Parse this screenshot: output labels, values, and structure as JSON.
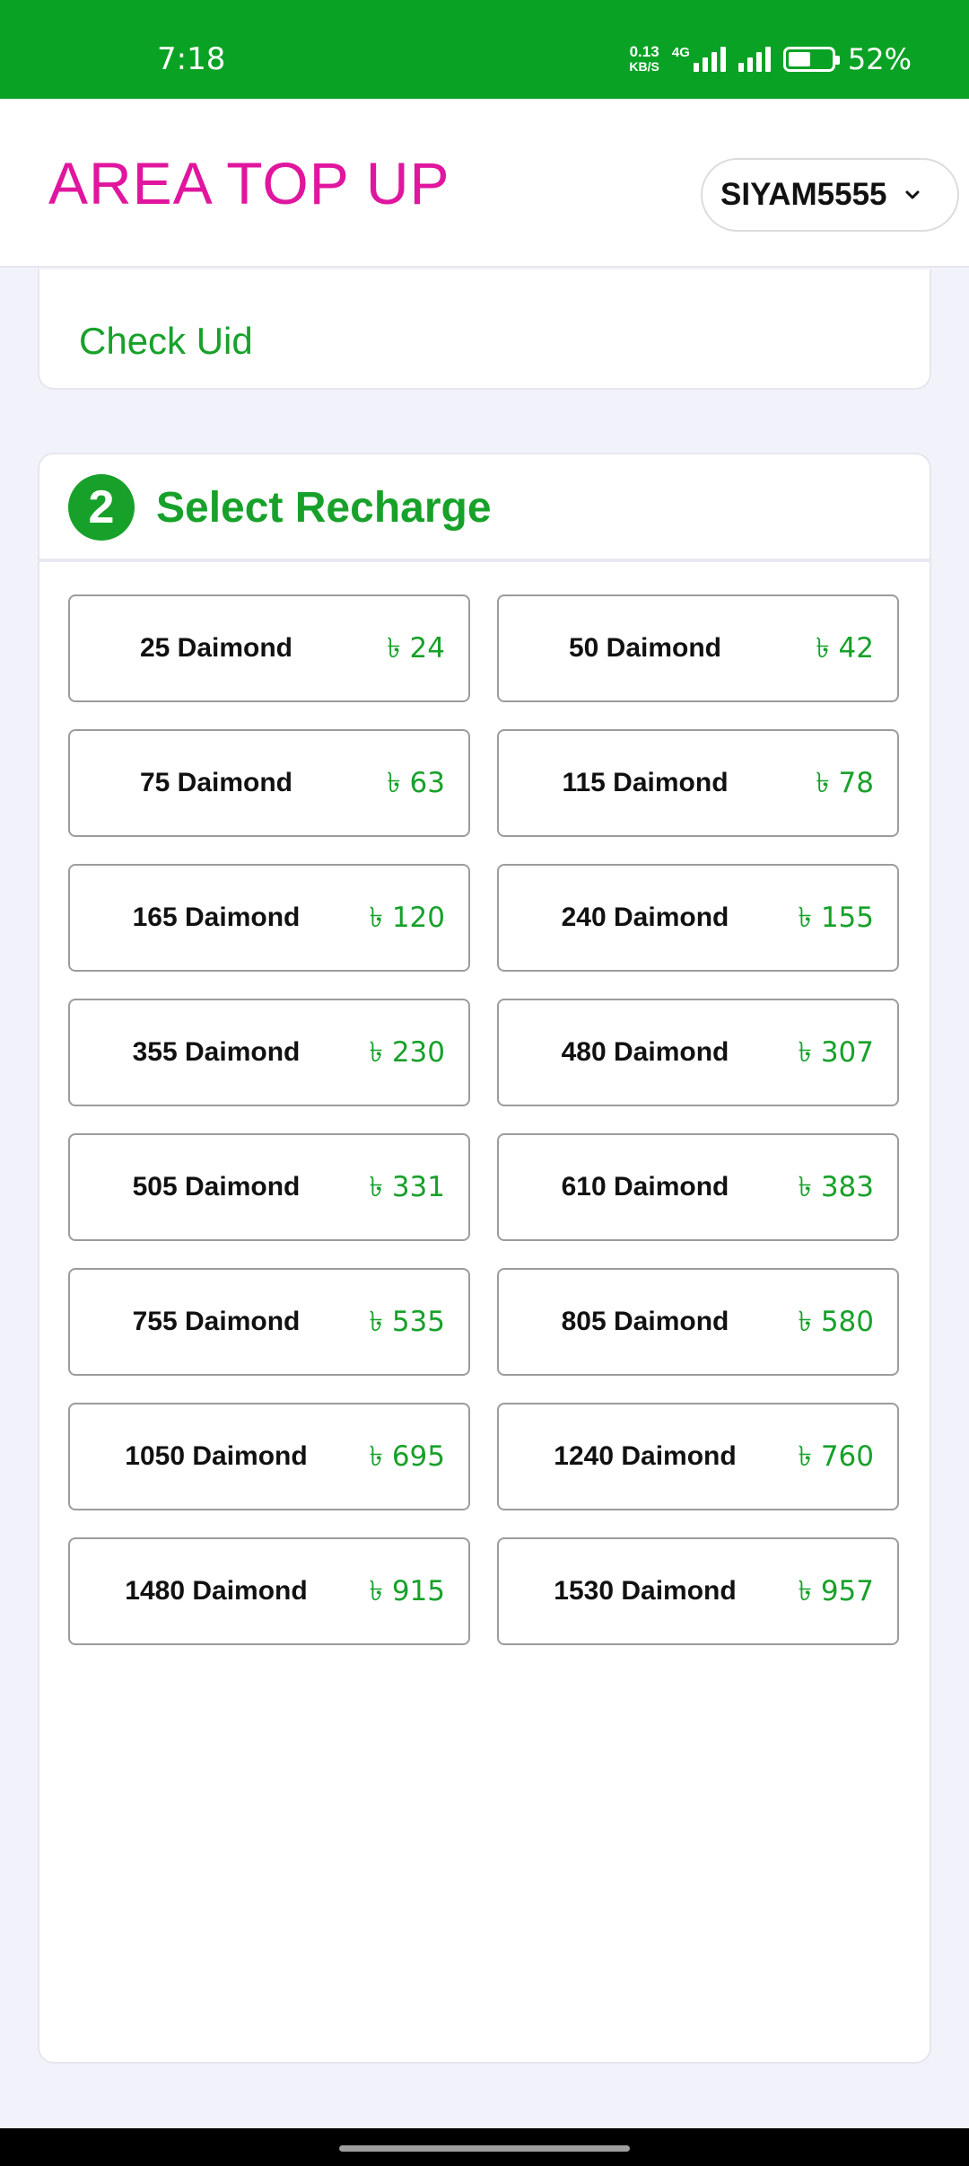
{
  "status_bar": {
    "time": "7:18",
    "net_speed_value": "0.13",
    "net_speed_unit": "KB/S",
    "net_type": "4G",
    "battery_percent": 52,
    "battery_text": "52%",
    "color": "#0aa224"
  },
  "header": {
    "brand": "AREA TOP UP",
    "brand_color": "#e0169e",
    "user_select": "SIYAM5555"
  },
  "check_section": {
    "link_label": "Check Uid"
  },
  "recharge_section": {
    "step_number": "2",
    "title": "Select Recharge",
    "accent_color": "#17a12a",
    "packages": [
      {
        "name": "25 Daimond",
        "price": "৳ 24"
      },
      {
        "name": "50 Daimond",
        "price": "৳ 42"
      },
      {
        "name": "75 Daimond",
        "price": "৳ 63"
      },
      {
        "name": "115 Daimond",
        "price": "৳ 78"
      },
      {
        "name": "165 Daimond",
        "price": "৳ 120"
      },
      {
        "name": "240 Daimond",
        "price": "৳ 155"
      },
      {
        "name": "355 Daimond",
        "price": "৳ 230"
      },
      {
        "name": "480 Daimond",
        "price": "৳ 307"
      },
      {
        "name": "505 Daimond",
        "price": "৳ 331"
      },
      {
        "name": "610 Daimond",
        "price": "৳ 383"
      },
      {
        "name": "755 Daimond",
        "price": "৳ 535"
      },
      {
        "name": "805 Daimond",
        "price": "৳ 580"
      },
      {
        "name": "1050 Daimond",
        "price": "৳ 695"
      },
      {
        "name": "1240 Daimond",
        "price": "৳ 760"
      },
      {
        "name": "1480 Daimond",
        "price": "৳ 915"
      },
      {
        "name": "1530 Daimond",
        "price": "৳ 957"
      }
    ]
  }
}
